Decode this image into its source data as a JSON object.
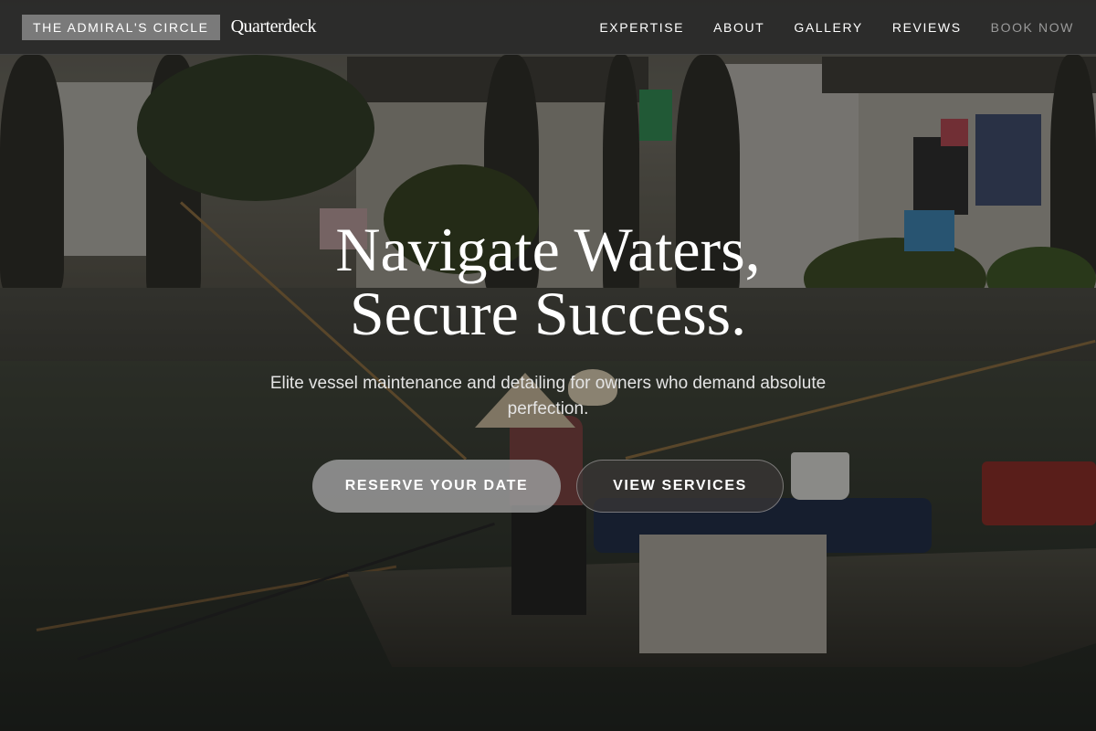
{
  "nav": {
    "badge": "THE ADMIRAL'S CIRCLE",
    "brand": "Quarterdeck",
    "links": [
      {
        "label": "EXPERTISE"
      },
      {
        "label": "ABOUT"
      },
      {
        "label": "GALLERY"
      },
      {
        "label": "REVIEWS"
      },
      {
        "label": "BOOK NOW"
      }
    ]
  },
  "hero": {
    "title_line1": "Navigate Waters,",
    "title_line2": "Secure Success.",
    "subtitle": "Elite vessel maintenance and detailing for owners who demand absolute perfection.",
    "primary_button": "RESERVE YOUR DATE",
    "secondary_button": "VIEW SERVICES"
  },
  "colors": {
    "nav_background": "#2b2b2b",
    "badge_background": "#7a7a7a",
    "text": "#ffffff",
    "muted_link": "#9a9a9a",
    "primary_button": "#969696"
  }
}
